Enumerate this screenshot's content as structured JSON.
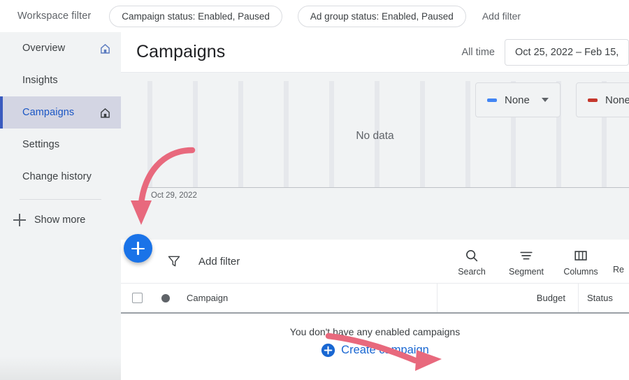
{
  "topbar": {
    "workspace_filter_label": "Workspace filter",
    "chips": [
      "Campaign status: Enabled, Paused",
      "Ad group status: Enabled, Paused"
    ],
    "add_filter_label": "Add filter"
  },
  "sidebar": {
    "items": [
      {
        "label": "Overview",
        "icon": "home-icon",
        "active": false
      },
      {
        "label": "Insights",
        "icon": null,
        "active": false
      },
      {
        "label": "Campaigns",
        "icon": "home-icon",
        "active": true
      },
      {
        "label": "Settings",
        "icon": null,
        "active": false
      },
      {
        "label": "Change history",
        "icon": null,
        "active": false
      }
    ],
    "show_more_label": "Show more",
    "show_more_icon": "plus-icon"
  },
  "header": {
    "page_title": "Campaigns",
    "all_time_label": "All time",
    "date_range": "Oct 25, 2022 – Feb 15,"
  },
  "chart": {
    "metric_a": {
      "label": "None",
      "color": "#4285f4",
      "caret_icon": "chevron-down-icon"
    },
    "metric_b": {
      "label": "None",
      "color": "#c5372c",
      "caret_icon": "chevron-down-icon"
    },
    "no_data_label": "No data",
    "x_axis_start_label": "Oct 29, 2022"
  },
  "chart_data": {
    "type": "line",
    "title": "",
    "series": [
      {
        "name": "None",
        "color": "#4285f4",
        "values": []
      },
      {
        "name": "None",
        "color": "#c5372c",
        "values": []
      }
    ],
    "x": [],
    "xlabel": "",
    "ylabel": "",
    "tick_labels": [
      "Oct 29, 2022"
    ],
    "grid": true,
    "legend": "top-right",
    "empty_message": "No data"
  },
  "toolbar": {
    "filter_icon": "funnel-icon",
    "add_filter_label": "Add filter",
    "tools": [
      {
        "label": "Search",
        "icon": "search-icon"
      },
      {
        "label": "Segment",
        "icon": "segment-icon"
      },
      {
        "label": "Columns",
        "icon": "columns-icon"
      },
      {
        "label": "Re",
        "icon": "reports-icon"
      }
    ]
  },
  "table": {
    "columns": {
      "campaign": "Campaign",
      "budget": "Budget",
      "status": "Status"
    },
    "rows": [],
    "empty_message": "You don't have any enabled campaigns",
    "create_link_label": "Create campaign",
    "create_link_icon": "plus-circle-icon",
    "create_link_color": "#1967d2"
  },
  "fab": {
    "icon": "plus-icon",
    "color": "#1a73e8"
  },
  "annotations": {
    "arrow_color": "#e8697d",
    "arrow_to_fab": "curved arrow pointing down to the blue add button",
    "arrow_to_create": "curved arrow pointing right to Create campaign link"
  }
}
